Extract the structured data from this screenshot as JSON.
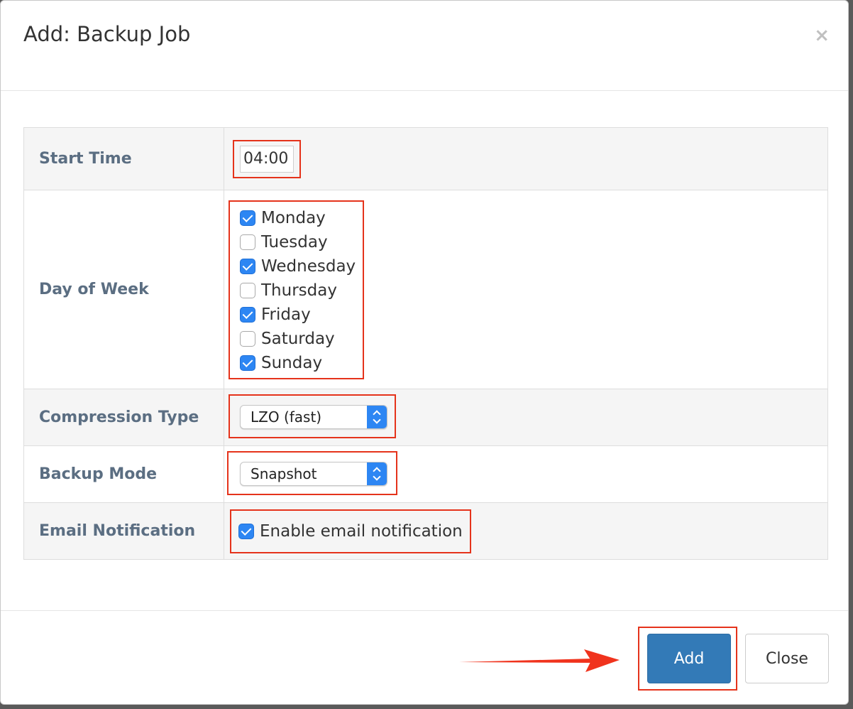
{
  "modal": {
    "title": "Add: Backup Job",
    "close_icon": "×"
  },
  "form": {
    "start_time": {
      "label": "Start Time",
      "value": "04:00"
    },
    "day_of_week": {
      "label": "Day of Week",
      "days": [
        {
          "label": "Monday",
          "checked": true
        },
        {
          "label": "Tuesday",
          "checked": false
        },
        {
          "label": "Wednesday",
          "checked": true
        },
        {
          "label": "Thursday",
          "checked": false
        },
        {
          "label": "Friday",
          "checked": true
        },
        {
          "label": "Saturday",
          "checked": false
        },
        {
          "label": "Sunday",
          "checked": true
        }
      ]
    },
    "compression_type": {
      "label": "Compression Type",
      "selected": "LZO (fast)"
    },
    "backup_mode": {
      "label": "Backup Mode",
      "selected": "Snapshot"
    },
    "email_notification": {
      "label": "Email Notification",
      "option_label": "Enable email notification",
      "checked": true
    }
  },
  "footer": {
    "add_label": "Add",
    "close_label": "Close"
  },
  "colors": {
    "highlight": "#e5331b",
    "primary": "#337ab7",
    "checkbox": "#2d86f3",
    "label_text": "#5b6e82"
  },
  "icons": [
    "close-icon",
    "checkmark-icon",
    "select-chevron-icon",
    "annotation-arrow-icon"
  ]
}
